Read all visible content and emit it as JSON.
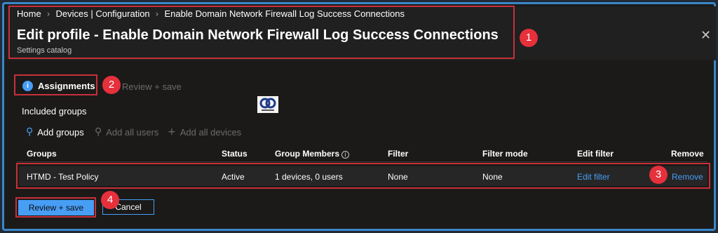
{
  "breadcrumb": [
    "Home",
    "Devices | Configuration",
    "Enable Domain Network Firewall Log Success Connections"
  ],
  "header": {
    "title": "Edit profile - Enable Domain Network Firewall Log Success Connections",
    "subtitle": "Settings catalog",
    "close_icon": "close-icon"
  },
  "steps": {
    "active": {
      "number": "1",
      "label": "Assignments"
    },
    "inactive": {
      "label": "Review + save"
    }
  },
  "section_title": "Included groups",
  "commands": {
    "add_groups": "Add groups",
    "add_all_users": "Add all users",
    "add_all_devices": "Add all devices"
  },
  "table": {
    "headers": [
      "Groups",
      "Status",
      "Group Members",
      "Filter",
      "Filter mode",
      "Edit filter",
      "Remove"
    ],
    "rows": [
      {
        "group": "HTMD - Test Policy",
        "status": "Active",
        "members": "1 devices, 0 users",
        "filter": "None",
        "filter_mode": "None",
        "edit_filter": "Edit filter",
        "remove": "Remove"
      }
    ]
  },
  "footer": {
    "primary": "Review + save",
    "secondary": "Cancel"
  },
  "annotations": [
    "1",
    "2",
    "3",
    "4"
  ],
  "colors": {
    "accent": "#479ef5",
    "annotation": "#e6303b",
    "border": "#3a87c9",
    "background": "#1b1a19"
  }
}
